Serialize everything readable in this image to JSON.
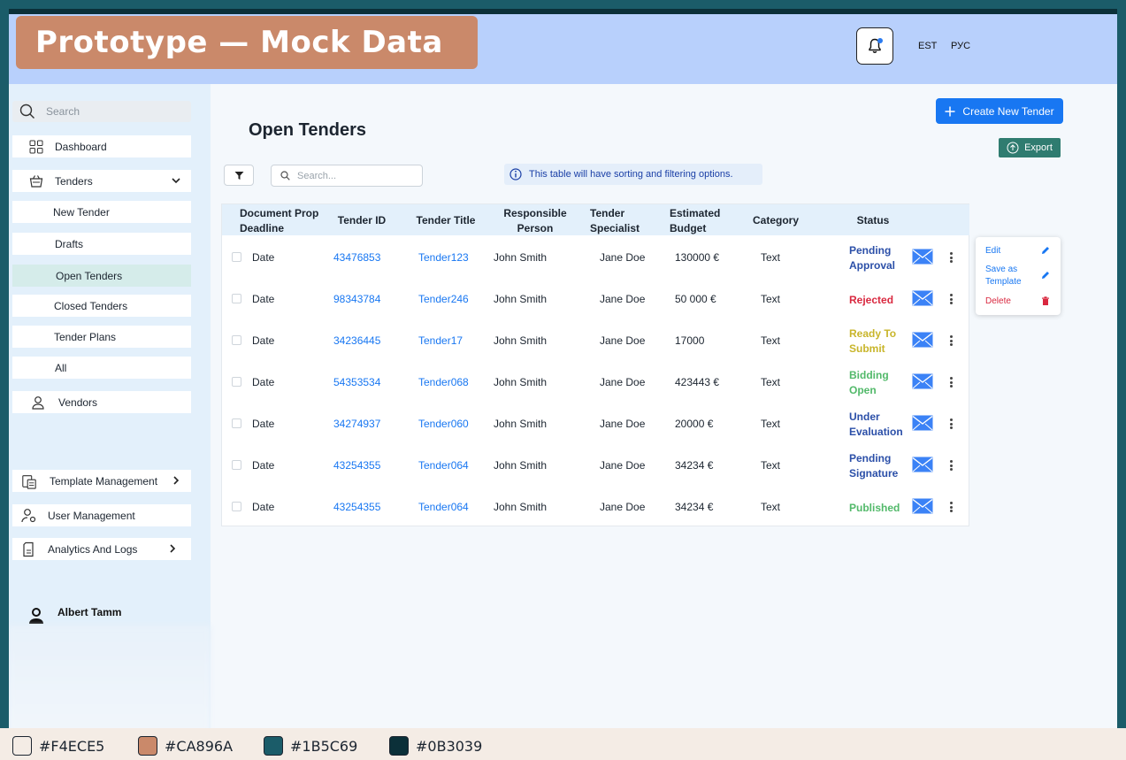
{
  "banner": "Prototype — Mock Data",
  "header": {
    "languages": [
      "EST",
      "РУС"
    ]
  },
  "sidebar": {
    "search_placeholder": "Search",
    "items": [
      {
        "label": "Dashboard"
      },
      {
        "label": "Tenders"
      },
      {
        "label": "New Tender"
      },
      {
        "label": "Drafts"
      },
      {
        "label": "Open Tenders"
      },
      {
        "label": "Closed Tenders"
      },
      {
        "label": "Tender Plans"
      },
      {
        "label": "All"
      },
      {
        "label": "Vendors"
      },
      {
        "label": "Template Management"
      },
      {
        "label": "User Management"
      },
      {
        "label": "Analytics And Logs"
      }
    ],
    "user": {
      "name": "Albert Tamm"
    }
  },
  "main": {
    "title": "Open Tenders",
    "create_button": "Create New Tender",
    "export_button": "Export",
    "search_placeholder": "Search...",
    "info_note": "This table will have sorting and filtering options.",
    "columns": [
      "Document Prop Deadline",
      "Tender ID",
      "Tender Title",
      "Responsible Person",
      "Tender Specialist",
      "Estimated Budget",
      "Category",
      "Status"
    ],
    "rows": [
      {
        "deadline": "Date",
        "id": "43476853",
        "title": "Tender123",
        "person": "John Smith",
        "specialist": "Jane Doe",
        "budget": "130000 €",
        "category": "Text",
        "status": "Pending Approval"
      },
      {
        "deadline": "Date",
        "id": "98343784",
        "title": "Tender246",
        "person": "John Smith",
        "specialist": "Jane Doe",
        "budget": "50 000 €",
        "category": "Text",
        "status": "Rejected"
      },
      {
        "deadline": "Date",
        "id": "34236445",
        "title": "Tender17",
        "person": "John Smith",
        "specialist": "Jane Doe",
        "budget": "17000",
        "category": "Text",
        "status": "Ready To Submit"
      },
      {
        "deadline": "Date",
        "id": "54353534",
        "title": "Tender068",
        "person": "John Smith",
        "specialist": "Jane Doe",
        "budget": "423443 €",
        "category": "Text",
        "status": "Bidding Open"
      },
      {
        "deadline": "Date",
        "id": "34274937",
        "title": "Tender060",
        "person": "John Smith",
        "specialist": "Jane Doe",
        "budget": "20000 €",
        "category": "Text",
        "status": "Under Evaluation"
      },
      {
        "deadline": "Date",
        "id": "43254355",
        "title": "Tender064",
        "person": "John Smith",
        "specialist": "Jane Doe",
        "budget": "34234 €",
        "category": "Text",
        "status": "Pending Signature"
      },
      {
        "deadline": "Date",
        "id": "43254355",
        "title": "Tender064",
        "person": "John Smith",
        "specialist": "Jane Doe",
        "budget": "34234 €",
        "category": "Text",
        "status": "Published"
      }
    ],
    "status_colors": {
      "Pending Approval": "#2B4FA8",
      "Rejected": "#D9283F",
      "Ready To Submit": "#C8B52A",
      "Bidding Open": "#52B96A",
      "Under Evaluation": "#2B4FA8",
      "Pending Signature": "#2B4FA8",
      "Published": "#52B96A"
    }
  },
  "context_menu": {
    "edit": "Edit",
    "save_template": "Save as Template",
    "delete": "Delete"
  },
  "palette": [
    "#F4ECE5",
    "#CA896A",
    "#1B5C69",
    "#0B3039"
  ]
}
